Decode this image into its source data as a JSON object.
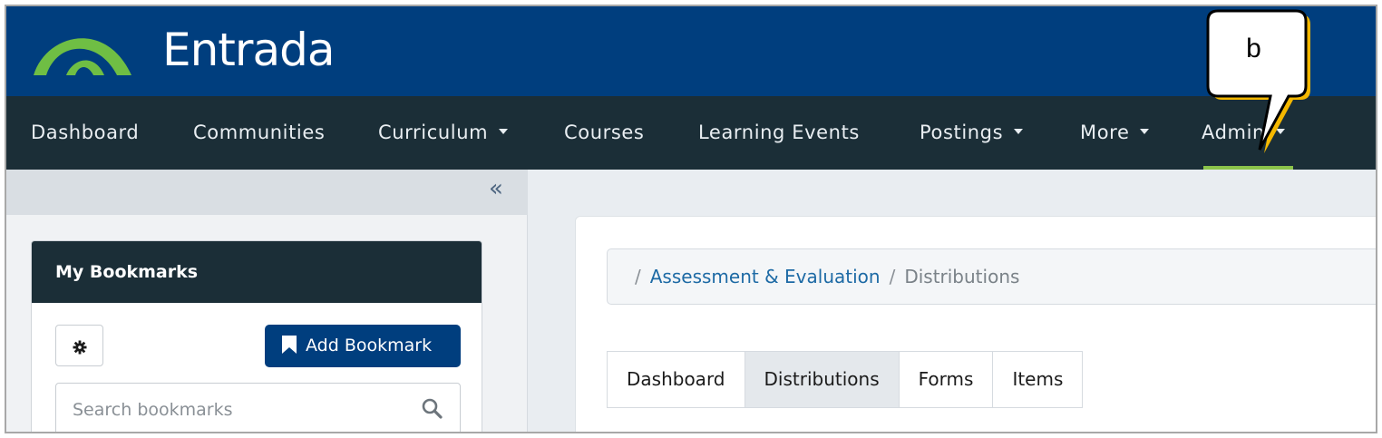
{
  "app": {
    "logo_text": "Entrada"
  },
  "nav": {
    "items": [
      {
        "label": "Dashboard",
        "dropdown": false
      },
      {
        "label": "Communities",
        "dropdown": false
      },
      {
        "label": "Curriculum",
        "dropdown": true
      },
      {
        "label": "Courses",
        "dropdown": false
      },
      {
        "label": "Learning Events",
        "dropdown": false
      },
      {
        "label": "Postings",
        "dropdown": true
      },
      {
        "label": "More",
        "dropdown": true
      },
      {
        "label": "Admin",
        "dropdown": true,
        "active": true
      }
    ]
  },
  "sidebar": {
    "collapse_icon": "double-chevron-left-icon",
    "bookmarks": {
      "title": "My Bookmarks",
      "settings_icon": "gear-icon",
      "add_label": "Add Bookmark",
      "search_placeholder": "Search bookmarks"
    }
  },
  "breadcrumb": {
    "link": "Assessment & Evaluation",
    "current": "Distributions"
  },
  "tabs": [
    {
      "label": "Dashboard",
      "active": false
    },
    {
      "label": "Distributions",
      "active": true
    },
    {
      "label": "Forms",
      "active": false
    },
    {
      "label": "Items",
      "active": false
    }
  ],
  "callout": {
    "label": "b"
  },
  "colors": {
    "brand_blue": "#003e7e",
    "nav_dark": "#1b2e37",
    "logo_green": "#6fbe44",
    "active_underline": "#8bc34a",
    "callout_arrow": "#f5b800"
  }
}
